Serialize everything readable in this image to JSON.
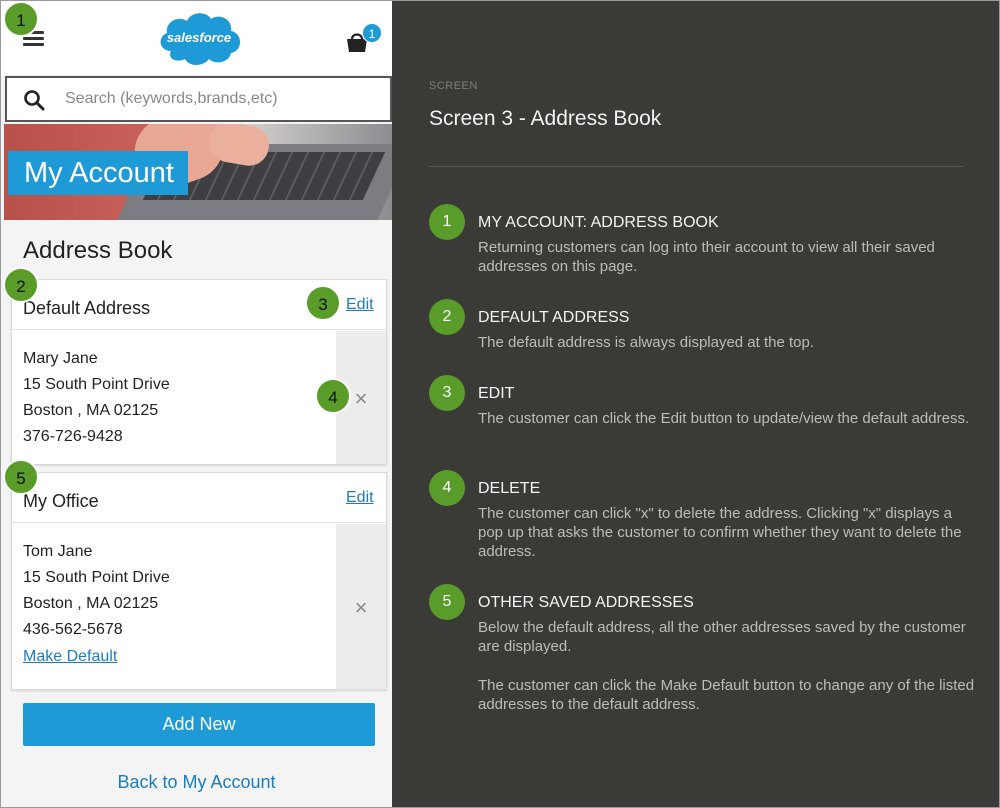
{
  "colors": {
    "accent": "#1e9ad6",
    "link": "#1a7dc0",
    "marker": "#5a9c2a",
    "panel_bg": "#3a3a36"
  },
  "header": {
    "logo_text": "salesforce",
    "cart_count": "1",
    "menu_icon": "hamburger-icon",
    "cart_icon": "shopping-bag-icon"
  },
  "search": {
    "placeholder": "Search (keywords,brands,etc)",
    "icon": "search-icon"
  },
  "banner": {
    "label": "My Account"
  },
  "page": {
    "title": "Address Book"
  },
  "addresses": [
    {
      "title": "Default Address",
      "edit_label": "Edit",
      "lines": [
        "Mary Jane",
        "15 South Point Drive",
        "Boston , MA 02125",
        "376-726-9428"
      ],
      "delete_glyph": "×"
    },
    {
      "title": "My Office",
      "edit_label": "Edit",
      "lines": [
        "Tom Jane",
        "15 South Point Drive",
        "Boston , MA 02125",
        "436-562-5678"
      ],
      "make_default_label": "Make Default",
      "delete_glyph": "×"
    }
  ],
  "actions": {
    "add_new": "Add New",
    "back": "Back to My Account"
  },
  "markers": [
    "1",
    "2",
    "3",
    "4",
    "5"
  ],
  "panel": {
    "eyebrow": "SCREEN",
    "title": "Screen 3 - Address Book",
    "notes": [
      {
        "num": "1",
        "title": "MY ACCOUNT: ADDRESS BOOK",
        "text": [
          "Returning customers can log into their account to view all their saved addresses on this page."
        ]
      },
      {
        "num": "2",
        "title": "DEFAULT ADDRESS",
        "text": [
          "The default address is always displayed at the top."
        ]
      },
      {
        "num": "3",
        "title": "EDIT",
        "text": [
          "The customer can click the Edit button to update/view the default address."
        ]
      },
      {
        "num": "4",
        "title": "DELETE",
        "text": [
          "The customer can click \"x\" to delete the address. Clicking \"x\" displays a pop up that asks the customer to confirm whether they want to delete the address."
        ]
      },
      {
        "num": "5",
        "title": "OTHER SAVED ADDRESSES",
        "text": [
          "Below the default address, all the other addresses saved by the customer are displayed.",
          "The customer can click the Make Default button to change any of the listed addresses to the default address."
        ]
      }
    ]
  }
}
